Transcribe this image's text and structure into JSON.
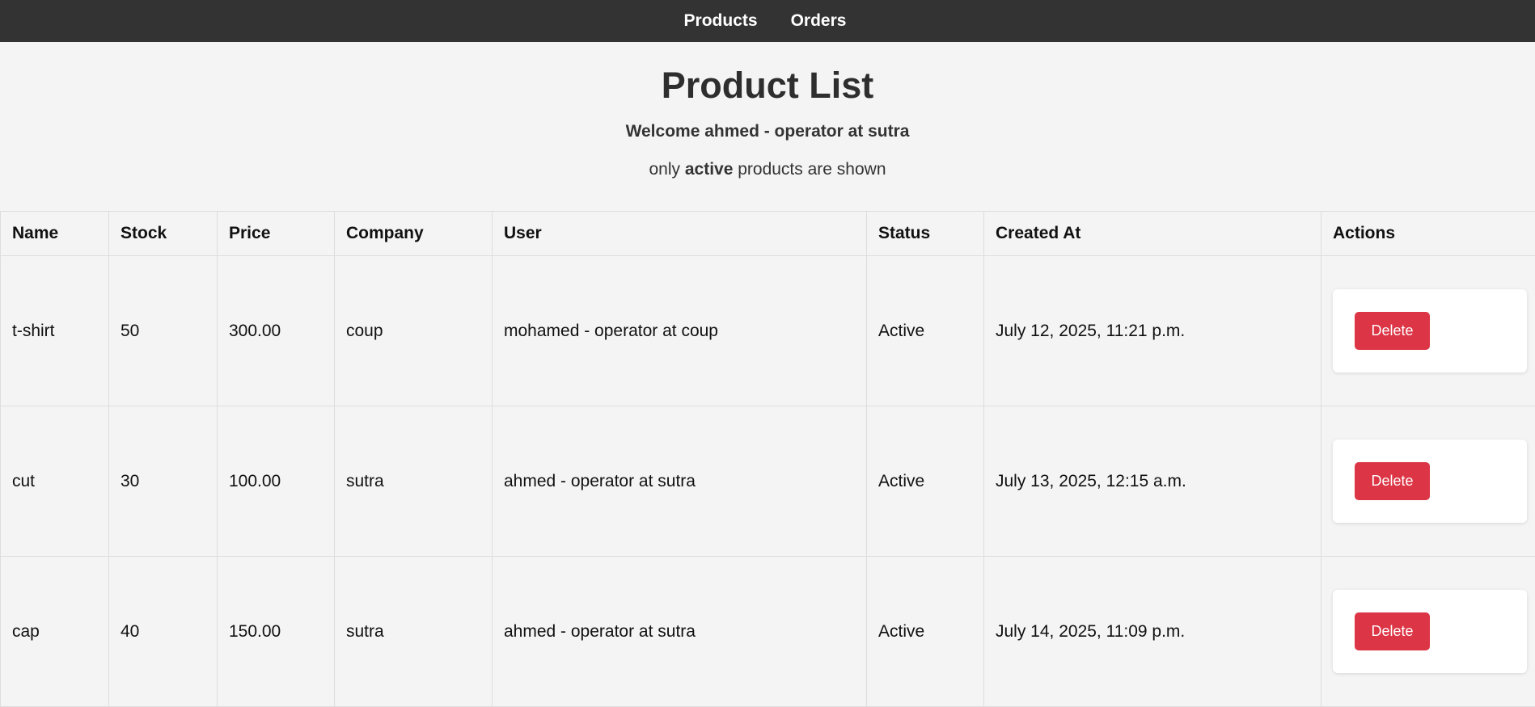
{
  "nav": {
    "items": [
      {
        "label": "Products"
      },
      {
        "label": "Orders"
      }
    ]
  },
  "page": {
    "title": "Product List",
    "welcome": "Welcome ahmed - operator at sutra",
    "notice_prefix": "only ",
    "notice_bold": "active",
    "notice_suffix": " products are shown"
  },
  "table": {
    "columns": [
      "Name",
      "Stock",
      "Price",
      "Company",
      "User",
      "Status",
      "Created At",
      "Actions"
    ],
    "rows": [
      {
        "name": "t-shirt",
        "stock": "50",
        "price": "300.00",
        "company": "coup",
        "user": "mohamed - operator at coup",
        "status": "Active",
        "created_at": "July 12, 2025, 11:21 p.m.",
        "action_label": "Delete"
      },
      {
        "name": "cut",
        "stock": "30",
        "price": "100.00",
        "company": "sutra",
        "user": "ahmed - operator at sutra",
        "status": "Active",
        "created_at": "July 13, 2025, 12:15 a.m.",
        "action_label": "Delete"
      },
      {
        "name": "cap",
        "stock": "40",
        "price": "150.00",
        "company": "sutra",
        "user": "ahmed - operator at sutra",
        "status": "Active",
        "created_at": "July 14, 2025, 11:09 p.m.",
        "action_label": "Delete"
      }
    ]
  },
  "colors": {
    "navbar": "#333333",
    "delete_button": "#dc3545",
    "page_background": "#f4f4f4"
  }
}
